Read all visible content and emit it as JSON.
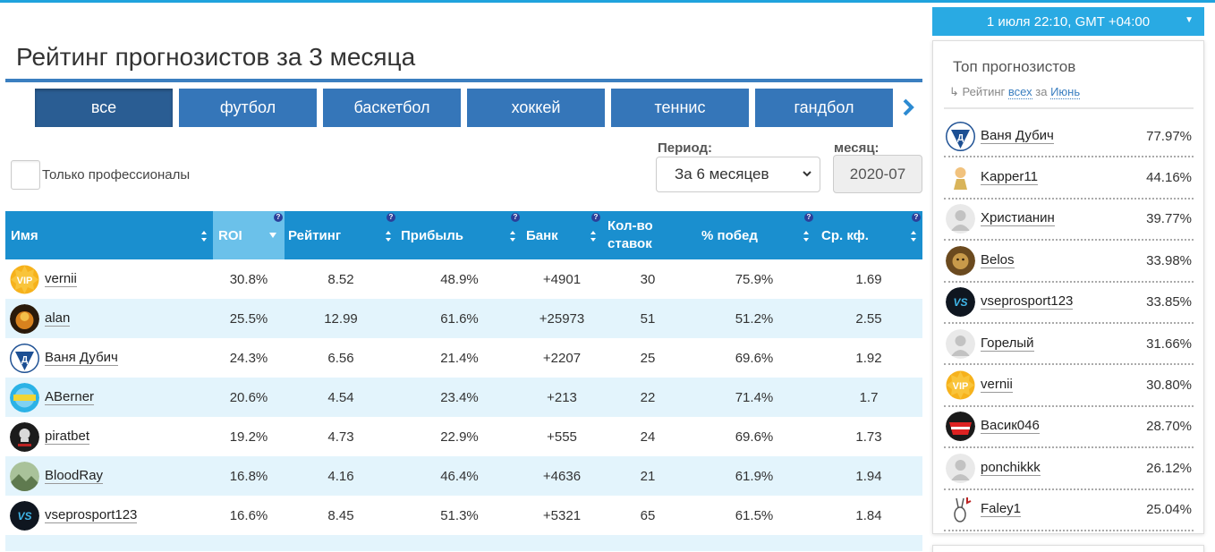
{
  "page_title": "Рейтинг прогнозистов за 3 месяца",
  "tabs": [
    "все",
    "футбол",
    "баскетбол",
    "хоккей",
    "теннис",
    "гандбол"
  ],
  "filters": {
    "pro_only_label": "Только профессионалы",
    "period_label": "Период:",
    "period_value": "За 6 месяцев",
    "month_label": "месяц:",
    "month_value": "2020-07"
  },
  "table": {
    "headers": {
      "name": "Имя",
      "roi": "ROI",
      "rating": "Рейтинг",
      "profit": "Прибыль",
      "bank": "Банк",
      "bets": "Кол-во ставок",
      "win": "% побед",
      "coef": "Ср. кф."
    },
    "help_mark": "?",
    "rows": [
      {
        "name": "vernii",
        "roi": "30.8%",
        "rating": "8.52",
        "profit": "48.9%",
        "bank": "+4901",
        "bets": "30",
        "win": "75.9%",
        "coef": "1.69",
        "avatar": "vip-icon"
      },
      {
        "name": "alan",
        "roi": "25.5%",
        "rating": "12.99",
        "profit": "61.6%",
        "bank": "+25973",
        "bets": "51",
        "win": "51.2%",
        "coef": "2.55",
        "avatar": "fire-avatar-icon"
      },
      {
        "name": "Ваня Дубич",
        "roi": "24.3%",
        "rating": "6.56",
        "profit": "21.4%",
        "bank": "+2207",
        "bets": "25",
        "win": "69.6%",
        "coef": "1.92",
        "avatar": "dynamo-logo-icon"
      },
      {
        "name": "ABerner",
        "roi": "20.6%",
        "rating": "4.54",
        "profit": "23.4%",
        "bank": "+213",
        "bets": "22",
        "win": "71.4%",
        "coef": "1.7",
        "avatar": "aberner-logo-icon"
      },
      {
        "name": "piratbet",
        "roi": "19.2%",
        "rating": "4.73",
        "profit": "22.9%",
        "bank": "+555",
        "bets": "24",
        "win": "69.6%",
        "coef": "1.73",
        "avatar": "pirate-skull-icon"
      },
      {
        "name": "BloodRay",
        "roi": "16.8%",
        "rating": "4.16",
        "profit": "46.4%",
        "bank": "+4636",
        "bets": "21",
        "win": "61.9%",
        "coef": "1.94",
        "avatar": "landscape-avatar-icon"
      },
      {
        "name": "vseprosport123",
        "roi": "16.6%",
        "rating": "8.45",
        "profit": "51.3%",
        "bank": "+5321",
        "bets": "65",
        "win": "61.5%",
        "coef": "1.84",
        "avatar": "vs-logo-icon"
      }
    ]
  },
  "sidebar": {
    "date": "1 июля 22:10, GMT +04:00",
    "title": "Топ прогнозистов",
    "subtitle_prefix": "Рейтинг",
    "subtitle_link_all": "всех",
    "subtitle_mid": "за",
    "subtitle_link_month": "Июнь",
    "top": [
      {
        "name": "Ваня Дубич",
        "pct": "77.97%",
        "avatar": "dynamo-logo-icon"
      },
      {
        "name": "Kapper11",
        "pct": "44.16%",
        "avatar": "cartoon-avatar-icon"
      },
      {
        "name": "Христианин",
        "pct": "39.77%",
        "avatar": "default-user-icon"
      },
      {
        "name": "Belos",
        "pct": "33.98%",
        "avatar": "lion-avatar-icon"
      },
      {
        "name": "vseprosport123",
        "pct": "33.85%",
        "avatar": "vs-logo-icon"
      },
      {
        "name": "Горелый",
        "pct": "31.66%",
        "avatar": "default-user-icon"
      },
      {
        "name": "vernii",
        "pct": "30.80%",
        "avatar": "vip-icon"
      },
      {
        "name": "Васик046",
        "pct": "28.70%",
        "avatar": "spartak-logo-icon"
      },
      {
        "name": "ponchikkk",
        "pct": "26.12%",
        "avatar": "default-user-icon"
      },
      {
        "name": "Faley1",
        "pct": "25.04%",
        "avatar": "rabbit-sketch-icon"
      }
    ]
  },
  "colors": {
    "accent": "#1a8fcf",
    "tab": "#3576b9",
    "tab_active": "#2a5d93",
    "roi_header": "#6bc1ea",
    "row_alt": "#e3f4fc",
    "date_bar": "#29aae3"
  }
}
